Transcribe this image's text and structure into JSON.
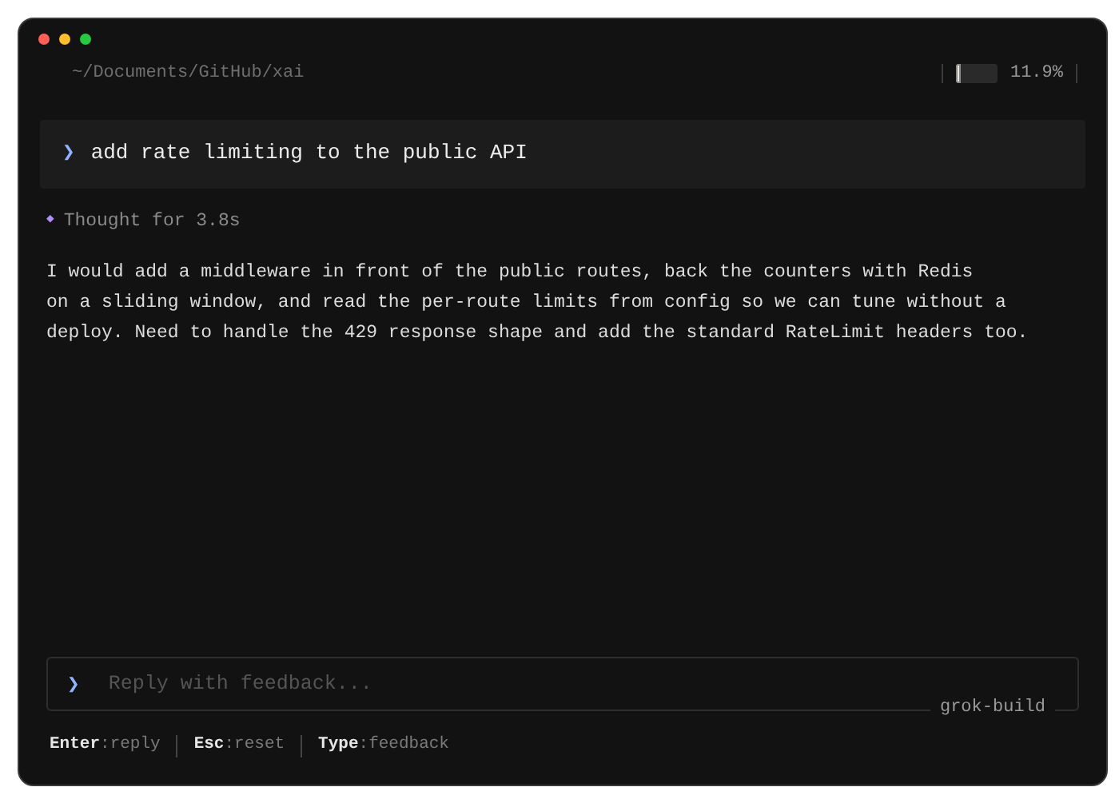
{
  "window": {
    "path": "~/Documents/GitHub/xai"
  },
  "context_meter": {
    "level": 0.119,
    "reading": "11.9%"
  },
  "prompt": {
    "marker": "❯",
    "text": "add rate limiting to the public API"
  },
  "thought": {
    "marker": "◆",
    "text": "Thought for 3.8s"
  },
  "response": "I would add a middleware in front of the public routes, back the counters with Redis\non a sliding window, and read the per-route limits from config so we can tune without a\ndeploy. Need to handle the 429 response shape and add the standard RateLimit headers too.",
  "input": {
    "marker": "❯",
    "placeholder": "Reply with feedback...",
    "model": "grok-build"
  },
  "hints": [
    {
      "key": "Enter",
      "action": ":reply"
    },
    {
      "key": "Esc",
      "action": ":reset"
    },
    {
      "key": "Type",
      "action": ":feedback"
    }
  ]
}
